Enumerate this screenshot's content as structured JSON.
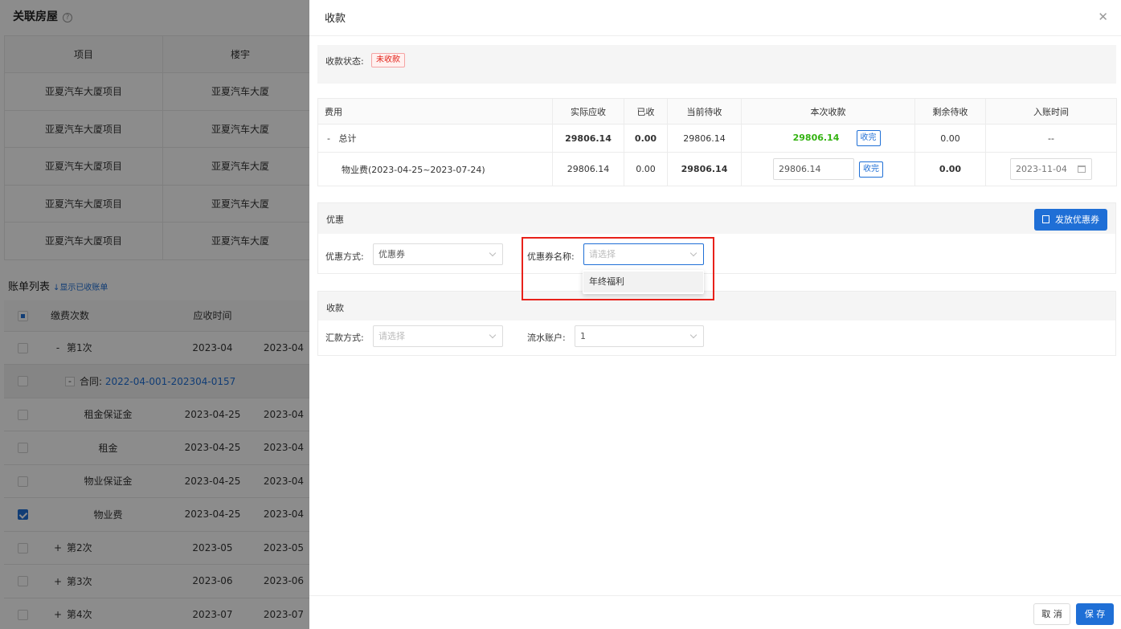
{
  "background": {
    "title": "关联房屋",
    "help_glyph": "?",
    "room_table": {
      "headers": [
        "项目",
        "楼宇"
      ],
      "rows": [
        [
          "亚夏汽车大厦项目",
          "亚夏汽车大厦"
        ],
        [
          "亚夏汽车大厦项目",
          "亚夏汽车大厦"
        ],
        [
          "亚夏汽车大厦项目",
          "亚夏汽车大厦"
        ],
        [
          "亚夏汽车大厦项目",
          "亚夏汽车大厦"
        ],
        [
          "亚夏汽车大厦项目",
          "亚夏汽车大厦"
        ]
      ]
    },
    "bill_list": {
      "title": "账单列表",
      "toggle_link": "↓显示已收账单",
      "headers": [
        "缴费次数",
        "应收时间"
      ],
      "rows": [
        {
          "expander": "-",
          "label": "第1次",
          "date": "2023-04",
          "extra": "2023-04"
        },
        {
          "expander": "-",
          "label": "合同:",
          "contract": "2022-04-001-202304-0157"
        },
        {
          "label": "租金保证金",
          "date": "2023-04-25",
          "extra": "2023-04"
        },
        {
          "label": "租金",
          "date": "2023-04-25",
          "extra": "2023-04"
        },
        {
          "label": "物业保证金",
          "date": "2023-04-25",
          "extra": "2023-04"
        },
        {
          "label": "物业费",
          "date": "2023-04-25",
          "extra": "2023-04",
          "checked": true
        },
        {
          "expander": "+",
          "label": "第2次",
          "date": "2023-05",
          "extra": "2023-05"
        },
        {
          "expander": "+",
          "label": "第3次",
          "date": "2023-06",
          "extra": "2023-06"
        },
        {
          "expander": "+",
          "label": "第4次",
          "date": "2023-07",
          "extra": "2023-07"
        }
      ]
    }
  },
  "drawer": {
    "title": "收款",
    "close_glyph": "✕",
    "status": {
      "label": "收款状态:",
      "value": "未收款"
    },
    "fee_table": {
      "headers": [
        "费用",
        "实际应收",
        "已收",
        "当前待收",
        "本次收款",
        "剩余待收",
        "入账时间"
      ],
      "total": {
        "expander": "-",
        "name": "总计",
        "actual": "29806.14",
        "received": "0.00",
        "pending": "29806.14",
        "this_payment": "29806.14",
        "btn": "收完",
        "remaining": "0.00",
        "time": "--"
      },
      "item": {
        "name": "物业费(2023-04-25~2023-07-24)",
        "actual": "29806.14",
        "received": "0.00",
        "pending": "29806.14",
        "this_payment": "29806.14",
        "btn": "收完",
        "remaining": "0.00",
        "time": "2023-11-04"
      }
    },
    "discount": {
      "title": "优惠",
      "issue_button": "发放优惠券",
      "method_label": "优惠方式:",
      "method_value": "优惠券",
      "coupon_label": "优惠券名称:",
      "coupon_placeholder": "请选择",
      "coupon_options": [
        "年终福利"
      ]
    },
    "payment": {
      "title": "收款",
      "method_label": "汇款方式:",
      "method_placeholder": "请选择",
      "account_label": "流水账户:",
      "account_value": "1"
    },
    "footer": {
      "cancel": "取 消",
      "save": "保 存"
    }
  },
  "colors": {
    "primary": "#1f6fd6",
    "danger": "#e2231a",
    "warning": "#f5a00b",
    "success": "#34b312"
  }
}
